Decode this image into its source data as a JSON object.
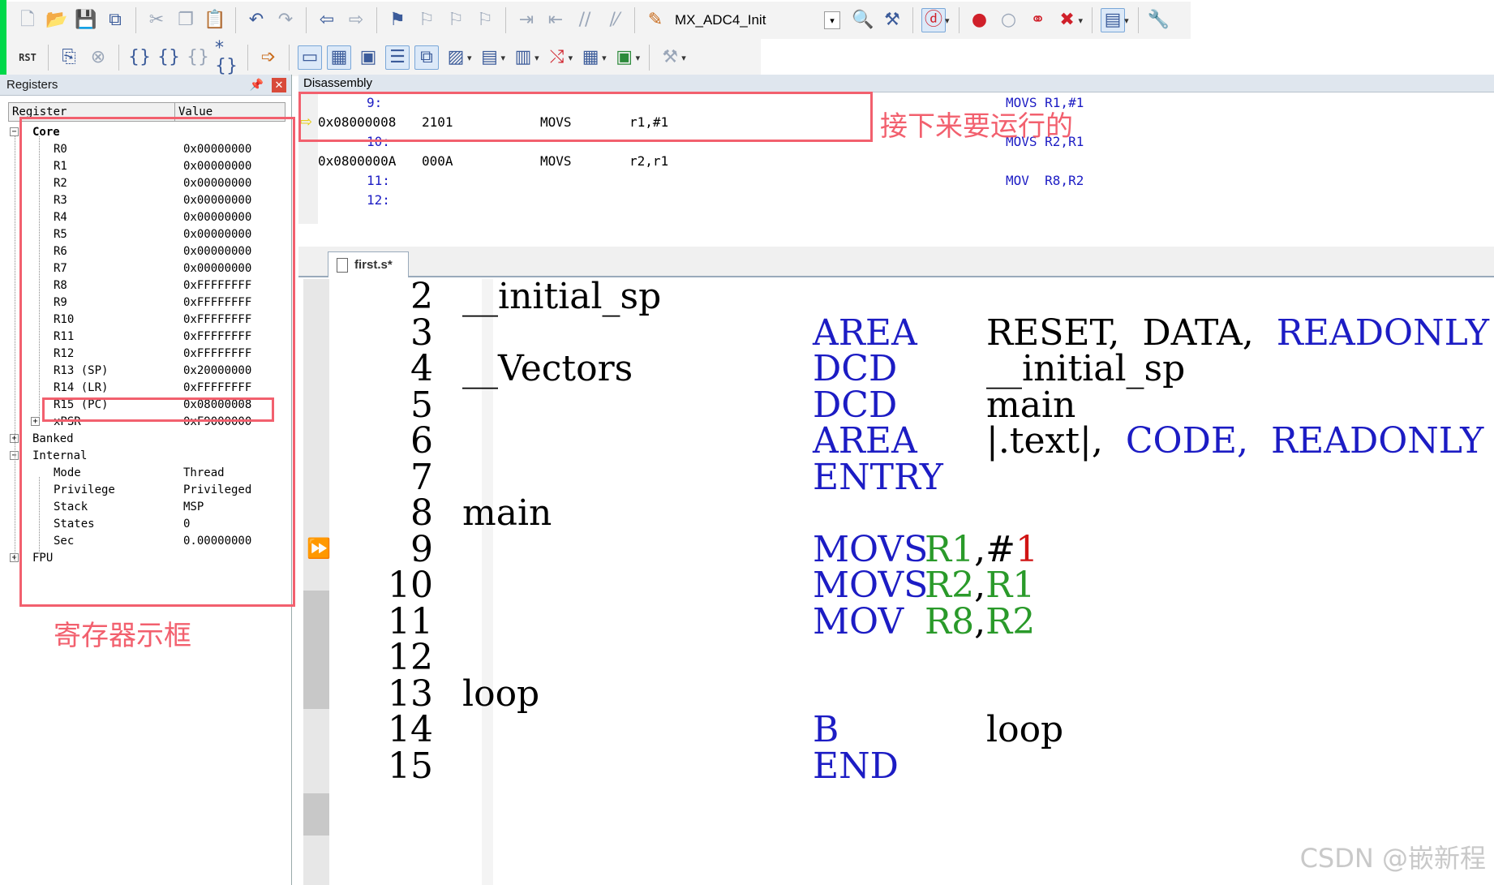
{
  "toolbar": {
    "target_name": "MX_ADC4_Init",
    "rst_label": "RST"
  },
  "registers": {
    "title": "Registers",
    "col_register": "Register",
    "col_value": "Value",
    "core_label": "Core",
    "core": [
      {
        "name": "R0",
        "value": "0x00000000"
      },
      {
        "name": "R1",
        "value": "0x00000000"
      },
      {
        "name": "R2",
        "value": "0x00000000"
      },
      {
        "name": "R3",
        "value": "0x00000000"
      },
      {
        "name": "R4",
        "value": "0x00000000"
      },
      {
        "name": "R5",
        "value": "0x00000000"
      },
      {
        "name": "R6",
        "value": "0x00000000"
      },
      {
        "name": "R7",
        "value": "0x00000000"
      },
      {
        "name": "R8",
        "value": "0xFFFFFFFF"
      },
      {
        "name": "R9",
        "value": "0xFFFFFFFF"
      },
      {
        "name": "R10",
        "value": "0xFFFFFFFF"
      },
      {
        "name": "R11",
        "value": "0xFFFFFFFF"
      },
      {
        "name": "R12",
        "value": "0xFFFFFFFF"
      },
      {
        "name": "R13 (SP)",
        "value": "0x20000000"
      },
      {
        "name": "R14 (LR)",
        "value": "0xFFFFFFFF"
      },
      {
        "name": "R15 (PC)",
        "value": "0x08000008"
      },
      {
        "name": "xPSR",
        "value": "0xF9000000"
      }
    ],
    "banked_label": "Banked",
    "internal_label": "Internal",
    "internal": [
      {
        "name": "Mode",
        "value": "Thread"
      },
      {
        "name": "Privilege",
        "value": "Privileged"
      },
      {
        "name": "Stack",
        "value": "MSP"
      },
      {
        "name": "States",
        "value": "0"
      },
      {
        "name": "Sec",
        "value": "0.00000000"
      }
    ],
    "fpu_label": "FPU"
  },
  "annotations": {
    "register_box_label": "寄存器示框",
    "next_run_label": "接下来要运行的"
  },
  "disassembly": {
    "title": "Disassembly",
    "lines": [
      {
        "kind": "src",
        "num": "9:",
        "code": "MOVS R1,#1"
      },
      {
        "kind": "asm",
        "addr": "0x08000008",
        "hex": "2101",
        "op": "MOVS",
        "args": "r1,#1"
      },
      {
        "kind": "src",
        "num": "10:",
        "code": "MOVS R2,R1"
      },
      {
        "kind": "asm",
        "addr": "0x0800000A",
        "hex": "000A",
        "op": "MOVS",
        "args": "r2,r1"
      },
      {
        "kind": "src",
        "num": "11:",
        "code": "MOV  R8,R2"
      },
      {
        "kind": "src",
        "num": "12:",
        "code": ""
      }
    ]
  },
  "editor": {
    "tab_label": "first.s*",
    "lines": [
      {
        "n": "2",
        "label": "__initial_sp",
        "op": "",
        "args": []
      },
      {
        "n": "3",
        "label": "",
        "op": "AREA",
        "args": [
          [
            "RESET,",
            "plain"
          ],
          [
            "DATA,",
            "plain"
          ],
          [
            "READONLY",
            "blue"
          ]
        ]
      },
      {
        "n": "4",
        "label": "__Vectors",
        "op": "DCD",
        "args": [
          [
            "__initial_sp",
            "plain"
          ]
        ]
      },
      {
        "n": "5",
        "label": "",
        "op": "DCD",
        "args": [
          [
            "main",
            "plain"
          ]
        ]
      },
      {
        "n": "6",
        "label": "",
        "op": "AREA",
        "args": [
          [
            "|.text|,",
            "plain"
          ],
          [
            "CODE,",
            "blue"
          ],
          [
            "READONLY",
            "blue"
          ]
        ]
      },
      {
        "n": "7",
        "label": "",
        "op": "ENTRY",
        "args": []
      },
      {
        "n": "8",
        "label": "main",
        "op": "",
        "args": []
      },
      {
        "n": "9",
        "label": "",
        "op": "MOVS",
        "args": [
          [
            "R1",
            "green"
          ],
          [
            ",#",
            "plain"
          ],
          [
            "1",
            "red"
          ]
        ]
      },
      {
        "n": "10",
        "label": "",
        "op": "MOVS",
        "args": [
          [
            "R2",
            "green"
          ],
          [
            ",",
            "plain"
          ],
          [
            "R1",
            "green"
          ]
        ]
      },
      {
        "n": "11",
        "label": "",
        "op": "MOV",
        "args": [
          [
            "R8",
            "green"
          ],
          [
            ",",
            "plain"
          ],
          [
            "R2",
            "green"
          ]
        ]
      },
      {
        "n": "12",
        "label": "",
        "op": "",
        "args": []
      },
      {
        "n": "13",
        "label": "loop",
        "op": "",
        "args": []
      },
      {
        "n": "14",
        "label": "",
        "op": "B",
        "args": [
          [
            "loop",
            "plain"
          ]
        ]
      },
      {
        "n": "15",
        "label": "",
        "op": "END",
        "args": []
      }
    ]
  },
  "watermark": "CSDN @嵌新程",
  "colors": {
    "annotation": "#f2606e",
    "keyword": "#1c1cc4",
    "register": "#2a9a2a",
    "immediate": "#d01414",
    "pc_marker": "#e6c800"
  }
}
